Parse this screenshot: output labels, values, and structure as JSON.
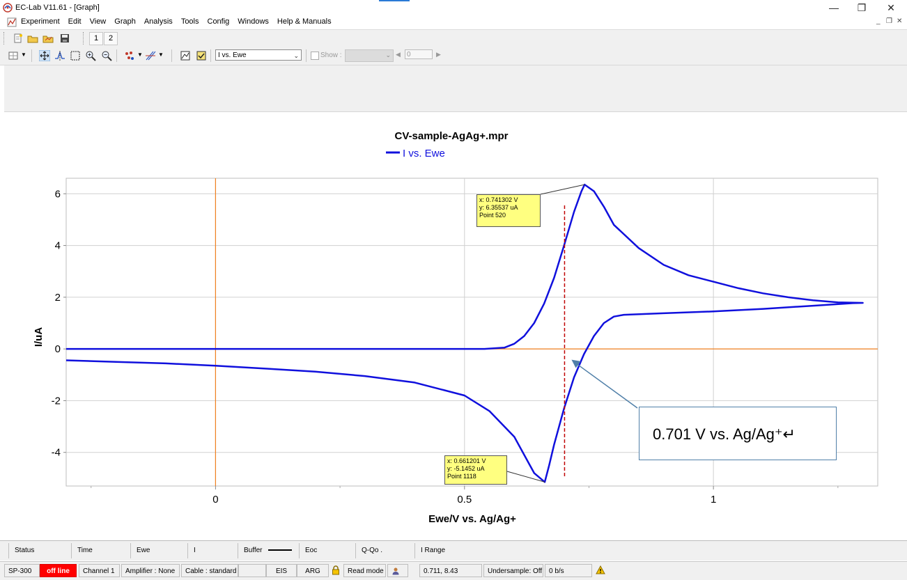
{
  "window": {
    "title": "EC-Lab V11.61 - [Graph]"
  },
  "menu": [
    "Experiment",
    "Edit",
    "View",
    "Graph",
    "Analysis",
    "Tools",
    "Config",
    "Windows",
    "Help & Manuals"
  ],
  "toolbar1": {
    "tabs": [
      "1",
      "2"
    ]
  },
  "toolbar2": {
    "graph_select": "I vs. Ewe",
    "show_label": "Show :",
    "point_index": "0"
  },
  "chart_data": {
    "type": "line",
    "title": "CV-sample-AgAg+.mpr",
    "legend": {
      "entries": [
        "I vs. Ewe"
      ],
      "placement": "top-center"
    },
    "xlabel": "Ewe/V vs. Ag/Ag+",
    "ylabel": "I/uA",
    "xlim": [
      -0.3,
      1.33
    ],
    "ylim": [
      -5.3,
      6.6
    ],
    "x_ticks": [
      0,
      0.5,
      1
    ],
    "y_ticks": [
      -4,
      -2,
      0,
      2,
      4,
      6
    ],
    "grid": true,
    "series_color": "#1010dd",
    "series": [
      {
        "name": "I vs. Ewe",
        "points": [
          [
            -0.3,
            0.0
          ],
          [
            0.3,
            0.0
          ],
          [
            0.54,
            0.0
          ],
          [
            0.58,
            0.05
          ],
          [
            0.6,
            0.2
          ],
          [
            0.62,
            0.5
          ],
          [
            0.64,
            1.0
          ],
          [
            0.66,
            1.75
          ],
          [
            0.68,
            2.75
          ],
          [
            0.7,
            4.0
          ],
          [
            0.72,
            5.3
          ],
          [
            0.735,
            6.1
          ],
          [
            0.741302,
            6.35537
          ],
          [
            0.76,
            6.1
          ],
          [
            0.78,
            5.5
          ],
          [
            0.8,
            4.8
          ],
          [
            0.85,
            3.9
          ],
          [
            0.9,
            3.25
          ],
          [
            0.95,
            2.85
          ],
          [
            1.0,
            2.6
          ],
          [
            1.05,
            2.35
          ],
          [
            1.1,
            2.15
          ],
          [
            1.15,
            2.0
          ],
          [
            1.2,
            1.88
          ],
          [
            1.25,
            1.8
          ],
          [
            1.3,
            1.78
          ],
          [
            1.28,
            1.77
          ],
          [
            1.2,
            1.67
          ],
          [
            1.1,
            1.55
          ],
          [
            1.0,
            1.45
          ],
          [
            0.9,
            1.38
          ],
          [
            0.82,
            1.32
          ],
          [
            0.8,
            1.25
          ],
          [
            0.78,
            1.0
          ],
          [
            0.76,
            0.5
          ],
          [
            0.74,
            -0.2
          ],
          [
            0.72,
            -1.1
          ],
          [
            0.7,
            -2.3
          ],
          [
            0.68,
            -3.7
          ],
          [
            0.67,
            -4.5
          ],
          [
            0.661201,
            -5.1452
          ],
          [
            0.64,
            -4.8
          ],
          [
            0.6,
            -3.4
          ],
          [
            0.55,
            -2.4
          ],
          [
            0.5,
            -1.8
          ],
          [
            0.4,
            -1.3
          ],
          [
            0.3,
            -1.05
          ],
          [
            0.2,
            -0.88
          ],
          [
            0.1,
            -0.76
          ],
          [
            0.0,
            -0.65
          ],
          [
            -0.1,
            -0.56
          ],
          [
            -0.2,
            -0.5
          ],
          [
            -0.3,
            -0.44
          ]
        ]
      }
    ],
    "reference_lines": {
      "x": 0,
      "y": 0,
      "color": "#f08020"
    },
    "marker_line": {
      "x": 0.701,
      "y_from": -4.95,
      "y_to": 5.55,
      "color": "#c00000",
      "style": "dashed"
    },
    "tooltips": [
      {
        "x_text": "x: 0.741302 V",
        "y_text": "y: 6.35537 uA",
        "point_text": "Point 520",
        "x": 0.741302,
        "y": 6.35537
      },
      {
        "x_text": "x: 0.661201 V",
        "y_text": "y: -5.1452 uA",
        "point_text": "Point 1118",
        "x": 0.661201,
        "y": -5.1452
      }
    ],
    "annotation": {
      "text": "0.701 V vs. Ag/Ag⁺↵",
      "arrow_to_x": 0.701,
      "arrow_to_y": -0.2
    }
  },
  "status_header": [
    "Status",
    "Time",
    "Ewe",
    "I",
    "Buffer",
    "Eoc",
    "Q-Qo  .",
    "I Range"
  ],
  "status_bar": {
    "device": "SP-300",
    "state": "off line",
    "channel": "Channel 1",
    "amplifier": "Amplifier : None",
    "cable": "Cable : standard",
    "eis": "EIS",
    "arg": "ARG",
    "read_mode": "Read mode",
    "cursor": "0.711, 8.43",
    "undersample": "Undersample: Off",
    "rate": "0 b/s"
  },
  "colors": {
    "toolbar_bg": "#f0f0f0",
    "curve": "#1010dd",
    "axis_ref": "#f08020",
    "offline": "#ff0000"
  }
}
